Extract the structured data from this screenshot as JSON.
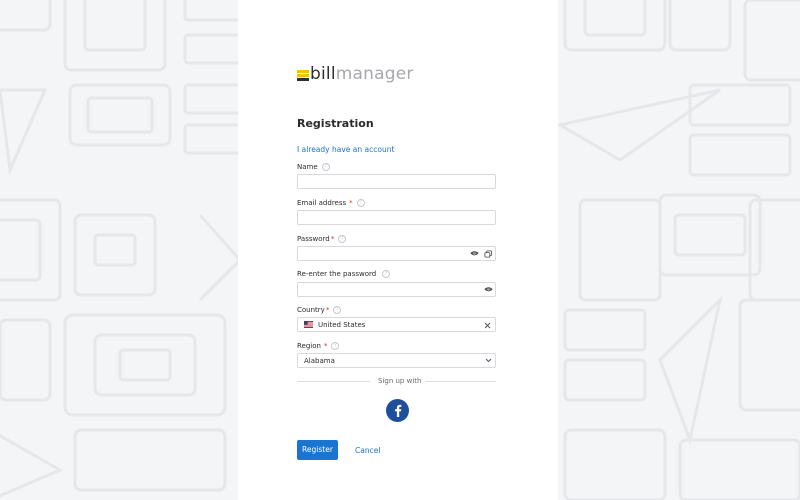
{
  "logo": {
    "bill": "bill",
    "manager": "manager"
  },
  "form": {
    "title": "Registration",
    "login_link": "I already have an account",
    "help_glyph": "?",
    "required_mark": "*",
    "name": {
      "label": "Name",
      "value": ""
    },
    "email": {
      "label": "Email address",
      "value": ""
    },
    "password": {
      "label": "Password",
      "value": ""
    },
    "password_confirm": {
      "label": "Re-enter the password",
      "value": ""
    },
    "country": {
      "label": "Country",
      "value": "United States",
      "flag": "us-flag-icon"
    },
    "region": {
      "label": "Region",
      "value": "Alabama"
    }
  },
  "social": {
    "divider_text": "Sign up with",
    "providers": [
      "facebook-icon"
    ]
  },
  "actions": {
    "register": "Register",
    "cancel": "Cancel"
  },
  "colors": {
    "accent": "#1b74d0",
    "link": "#1a73c7",
    "required": "#d0312d",
    "logo_yellow": "#f2c500",
    "facebook": "#1d4f9c"
  }
}
